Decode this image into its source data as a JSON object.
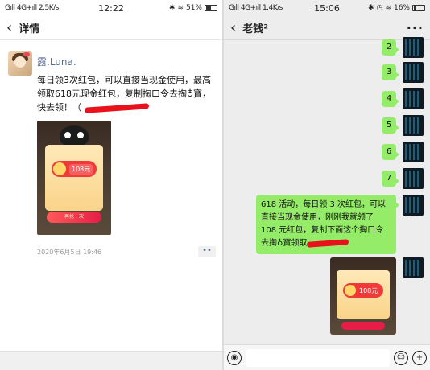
{
  "left": {
    "status": {
      "signal": "Gıll 4G+ıll 2.5K/s",
      "clock": "12:22",
      "battery": "51%",
      "battery_level": 0.51
    },
    "nav": {
      "back_icon": "chevron-left-icon",
      "title": "详情"
    },
    "moment": {
      "nickname": "露.Luna.",
      "text": "每日领3次红包，可以直接当现金使用，最高领取618元现金红包，复制掏口令去掏♁寶，快去领！（ ",
      "image": {
        "amount": "108元",
        "button": "再抢一次"
      },
      "time": "2020年6月5日 19:46",
      "more": "••"
    }
  },
  "right": {
    "status": {
      "signal": "Gıll 4G+ıll 1.4K/s",
      "clock": "15:06",
      "battery": "16%",
      "battery_level": 0.16
    },
    "nav": {
      "title": "老钱²",
      "more": "···"
    },
    "numbers": [
      "2",
      "3",
      "4",
      "5",
      "6",
      "7"
    ],
    "long_message": "618 活动，每日领 3 次红包，可以直接当现金使用，刚刚我就领了 108 元红包，复制下面这个掏口令去掏♁寶领取",
    "image_msg": {
      "amount": "108元"
    }
  }
}
